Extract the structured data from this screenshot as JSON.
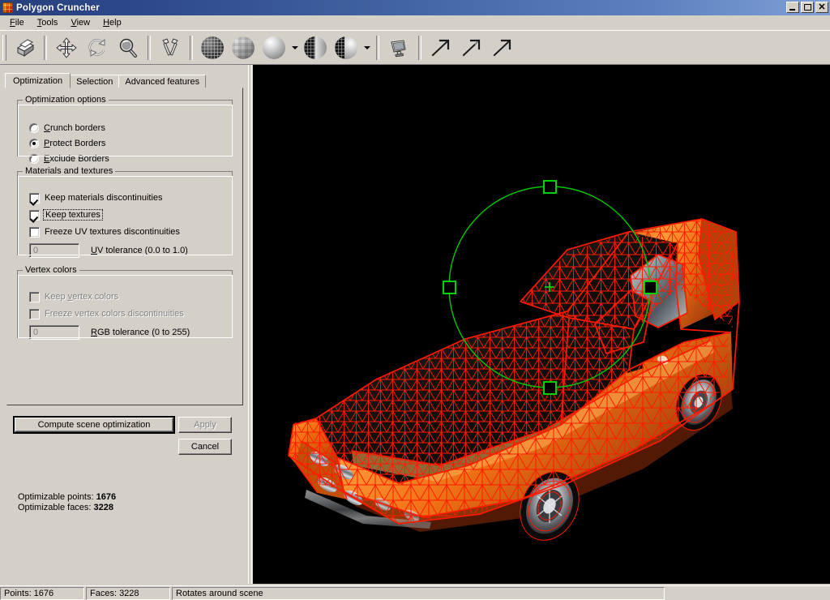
{
  "window": {
    "title": "Polygon Cruncher",
    "icon": "polygon-cruncher-icon",
    "minimize_label": "_",
    "maximize_label": "❐",
    "close_label": "✕"
  },
  "menubar": {
    "items": [
      {
        "label": "File",
        "accel": "F"
      },
      {
        "label": "Tools",
        "accel": "T"
      },
      {
        "label": "View",
        "accel": "V"
      },
      {
        "label": "Help",
        "accel": "H"
      }
    ]
  },
  "toolbar": {
    "buttons": [
      {
        "name": "print-icon",
        "title": "Print"
      },
      {
        "name": "pan-move-icon",
        "title": "Move"
      },
      {
        "name": "rotate-icon",
        "title": "Rotate"
      },
      {
        "name": "zoom-magnifier-icon",
        "title": "Zoom"
      },
      {
        "name": "tools-hammers-icon",
        "title": "Tools"
      },
      {
        "name": "render-wireframe-icon",
        "title": "Wireframe"
      },
      {
        "name": "render-flat-icon",
        "title": "Flat shading"
      },
      {
        "name": "render-smooth-icon",
        "title": "Smooth shading"
      },
      {
        "name": "render-wireframe-shaded-icon",
        "title": "Wireframe over shaded"
      },
      {
        "name": "render-wireframe-smooth-icon",
        "title": "Wireframe over smooth"
      },
      {
        "name": "display-monitor-icon",
        "title": "Display"
      },
      {
        "name": "arrow-diagonal-1-icon",
        "title": "Arrow 1"
      },
      {
        "name": "arrow-diagonal-2-icon",
        "title": "Arrow 2"
      },
      {
        "name": "arrow-diagonal-3-icon",
        "title": "Arrow 3"
      }
    ]
  },
  "panel": {
    "tabs": [
      {
        "label": "Optimization",
        "active": true
      },
      {
        "label": "Selection",
        "active": false
      },
      {
        "label": "Advanced features",
        "active": false
      }
    ],
    "optimization_options": {
      "legend": "Optimization options",
      "radios": [
        {
          "label": "Crunch borders",
          "accel": "C",
          "selected": false
        },
        {
          "label": "Protect Borders",
          "accel": "P",
          "selected": true
        },
        {
          "label": "Exclude Borders",
          "accel": "E",
          "selected": false
        }
      ]
    },
    "materials": {
      "legend": "Materials and textures",
      "checkboxes": [
        {
          "label": "Keep materials discontinuities",
          "checked": true,
          "enabled": true,
          "focused": false
        },
        {
          "label": "Keep textures",
          "checked": true,
          "enabled": true,
          "focused": true
        },
        {
          "label": "Freeze UV textures discontinuities",
          "checked": false,
          "enabled": true,
          "focused": false
        }
      ],
      "tolerance": {
        "value": "0",
        "label": "UV tolerance (0.0 to 1.0)",
        "accel": "U",
        "enabled": false
      }
    },
    "vertex_colors": {
      "legend": "Vertex colors",
      "checkboxes": [
        {
          "label": "Keep vertex colors",
          "checked": false,
          "enabled": false
        },
        {
          "label": "Freeze vertex colors discontinuities",
          "checked": false,
          "enabled": false
        }
      ],
      "tolerance": {
        "value": "0",
        "label": "RGB tolerance (0 to 255)",
        "accel": "R",
        "enabled": false
      }
    },
    "buttons": {
      "compute": {
        "label": "Compute scene optimization",
        "enabled": true,
        "default": true
      },
      "apply": {
        "label": "Apply",
        "enabled": false
      },
      "cancel": {
        "label": "Cancel",
        "enabled": true
      }
    },
    "stats": {
      "points_label": "Optimizable points:",
      "points_value": "1676",
      "faces_label": "Optimizable faces:",
      "faces_value": "3228"
    }
  },
  "viewport": {
    "background_color": "#000000",
    "model_name": "car-wireframe-model",
    "mesh_color": "#ff1a00",
    "body_color": "#e86a10",
    "gizmo": {
      "name": "rotation-trackball-gizmo",
      "color": "#00d000",
      "handles": [
        "top",
        "left",
        "right",
        "bottom"
      ],
      "center_marker": "crosshair"
    }
  },
  "statusbar": {
    "panes": [
      {
        "name": "points-pane",
        "text": "Points: 1676"
      },
      {
        "name": "faces-pane",
        "text": "Faces: 3228"
      },
      {
        "name": "hint-pane",
        "text": "Rotates around scene"
      }
    ]
  }
}
